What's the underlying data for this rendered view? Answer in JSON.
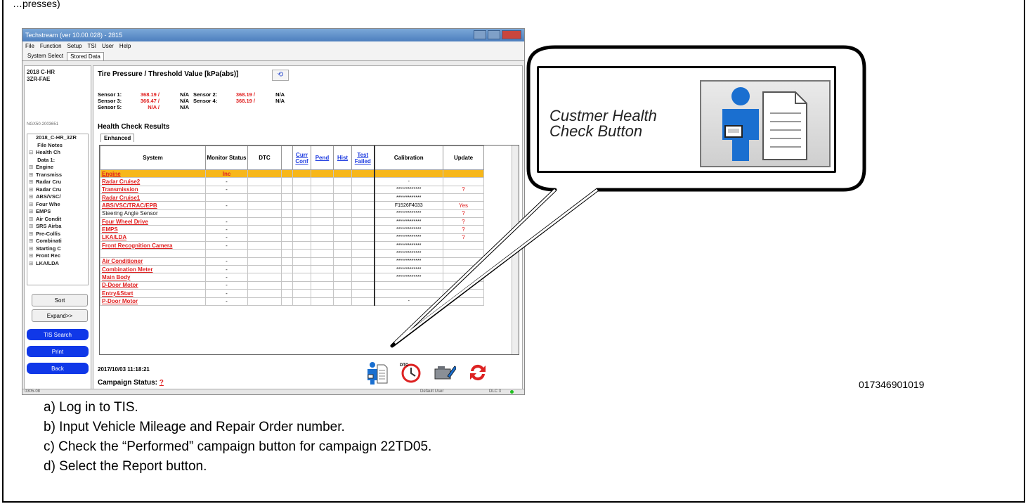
{
  "top_fragment": "…presses)",
  "window": {
    "title": "Techstream (ver 10.00.028) - 2815",
    "menu": [
      "File",
      "Function",
      "Setup",
      "TSI",
      "User",
      "Help"
    ],
    "tabs": [
      "System Select",
      "Stored Data"
    ]
  },
  "left_panel": {
    "vehicle_lines": [
      "2018 C-HR",
      "3ZR-FAE"
    ],
    "vin": "NGX50-2003651",
    "tree": [
      {
        "pm": "",
        "label": "2018_C-HR_3ZR"
      },
      {
        "pm": "",
        "label": "   File Notes"
      },
      {
        "pm": "⊟",
        "label": "Health Ch"
      },
      {
        "pm": "",
        "label": "     Data 1:"
      },
      {
        "pm": "⊞",
        "label": "Engine"
      },
      {
        "pm": "⊞",
        "label": "Transmiss"
      },
      {
        "pm": "⊞",
        "label": "Radar Cru"
      },
      {
        "pm": "⊞",
        "label": "Radar Cru"
      },
      {
        "pm": "⊞",
        "label": "ABS/VSC/"
      },
      {
        "pm": "⊞",
        "label": "Four Whe"
      },
      {
        "pm": "⊞",
        "label": "EMPS"
      },
      {
        "pm": "⊞",
        "label": "Air Condit"
      },
      {
        "pm": "⊞",
        "label": "SRS Airba"
      },
      {
        "pm": "⊞",
        "label": "Pre-Collis"
      },
      {
        "pm": "⊞",
        "label": "Combinati"
      },
      {
        "pm": "⊞",
        "label": "Starting C"
      },
      {
        "pm": "⊞",
        "label": "Front Rec"
      },
      {
        "pm": "⊞",
        "label": "LKA/LDA"
      }
    ],
    "sort_label": "Sort",
    "expand_label": "Expand>>",
    "tis_search_label": "TIS Search",
    "print_label": "Print",
    "back_label": "Back"
  },
  "tire_pressure": {
    "title": "Tire Pressure / Threshold Value [kPa(abs)]",
    "rows": [
      {
        "l1": "Sensor 1:",
        "v1": "368.19 /",
        "n1": "N/A",
        "l2": "Sensor 2:",
        "v2": "368.19 /",
        "n2": "N/A"
      },
      {
        "l1": "Sensor 3:",
        "v1": "366.47 /",
        "n1": "N/A",
        "l2": "Sensor 4:",
        "v2": "368.19 /",
        "n2": "N/A"
      },
      {
        "l1": "Sensor 5:",
        "v1": "N/A /",
        "n1": "N/A",
        "l2": "",
        "v2": "",
        "n2": ""
      }
    ]
  },
  "health": {
    "title": "Health Check Results",
    "tab": "Enhanced",
    "headers": {
      "system": "System",
      "monitor": "Monitor Status",
      "dtc": "DTC",
      "curr": "Curr Conf",
      "pend": "Pend",
      "hist": "Hist",
      "test": "Test Failed",
      "calibration": "Calibration",
      "update": "Update"
    },
    "rows": [
      {
        "system": "Engine",
        "monitor": "Inc",
        "cal": "",
        "upd": "",
        "hl": true
      },
      {
        "system": "Radar Cruise2",
        "monitor": "-",
        "cal": "-",
        "upd": ""
      },
      {
        "system": "Transmission",
        "monitor": "-",
        "cal": "*************",
        "upd": "?"
      },
      {
        "system": "Radar Cruise1",
        "monitor": "",
        "cal": "*************",
        "upd": ""
      },
      {
        "system": "ABS/VSC/TRAC/EPB",
        "monitor": "-",
        "cal": "F1526F4033",
        "upd": "Yes"
      },
      {
        "system": "Steering Angle Sensor",
        "monitor": "",
        "cal": "*************",
        "upd": "?",
        "plain": true
      },
      {
        "system": "Four Wheel Drive",
        "monitor": "-",
        "cal": "*************",
        "upd": "?"
      },
      {
        "system": "EMPS",
        "monitor": "-",
        "cal": "*************",
        "upd": "?"
      },
      {
        "system": "LKA/LDA",
        "monitor": "-",
        "cal": "*************",
        "upd": "?"
      },
      {
        "system": "Front Recognition Camera",
        "monitor": "-",
        "cal": "*************",
        "upd": ""
      },
      {
        "system": "",
        "monitor": "",
        "cal": "*************",
        "upd": ""
      },
      {
        "system": "Air Conditioner",
        "monitor": "-",
        "cal": "*************",
        "upd": ""
      },
      {
        "system": "Combination Meter",
        "monitor": "-",
        "cal": "*************",
        "upd": ""
      },
      {
        "system": "Main Body",
        "monitor": "-",
        "cal": "*************",
        "upd": ""
      },
      {
        "system": "D-Door Motor",
        "monitor": "-",
        "cal": "",
        "upd": ""
      },
      {
        "system": "Entry&Start",
        "monitor": "-",
        "cal": "",
        "upd": ""
      },
      {
        "system": "P-Door Motor",
        "monitor": "-",
        "cal": "-",
        "upd": ""
      }
    ]
  },
  "bottom": {
    "datetime": "2017/10/03 11:18:21",
    "campaign_label": "Campaign Status:",
    "campaign_value": "?"
  },
  "statusbar": {
    "left": "0305-08",
    "user": "Default User",
    "dlc": "DLC 3"
  },
  "callout": {
    "line1": "Custmer Health",
    "line2": "Check Button"
  },
  "figure_code": "017346901019",
  "steps": [
    "a)  Log in to TIS.",
    "b)  Input Vehicle Mileage and Repair Order number.",
    "c)  Check the “Performed” campaign button for campaign 22TD05.",
    "d)  Select the Report button."
  ],
  "colors": {
    "accent_red": "#e02020",
    "highlight_row": "#f7b71a",
    "nav_button": "#1038e8"
  }
}
